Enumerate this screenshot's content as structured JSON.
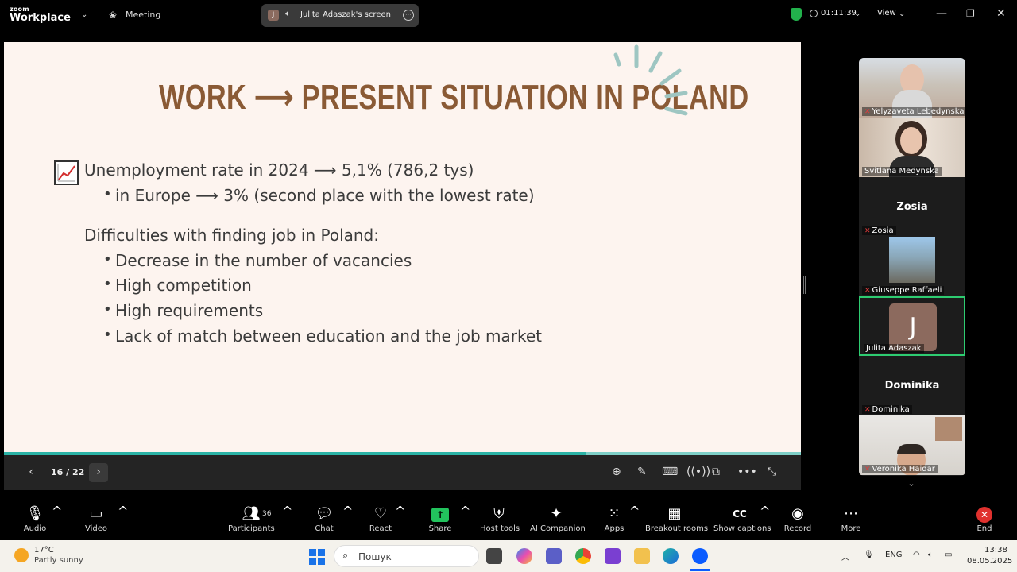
{
  "titlebar": {
    "logo_top": "zoom",
    "logo_bottom": "Workplace",
    "meeting_label": "Meeting",
    "share_avatar": "J",
    "share_text": "Julita Adaszak's screen",
    "timer": "01:11:39",
    "view_label": "View"
  },
  "slide": {
    "title": "WORK ⟶ PRESENT SITUATION IN POLAND",
    "line1": "Unemployment rate in 2024 ⟶ 5,1% (786,2 tys)",
    "line1_sub": "in Europe ⟶ 3% (second place with the lowest rate)",
    "heading2": "Difficulties with finding job in Poland:",
    "bullets": [
      "Decrease in the number of vacancies",
      "High competition",
      "High requirements",
      "Lack of match between education and the job market"
    ],
    "progress": 0.73
  },
  "slidebar": {
    "page_indicator": "16 / 22"
  },
  "participants": [
    {
      "name": "Yelyzaveta Lebedynska",
      "type": "video",
      "muted": true
    },
    {
      "name": "Svitlana Medynska",
      "type": "video",
      "muted": false
    },
    {
      "name": "Zosia",
      "type": "name",
      "display": "Zosia",
      "muted": true
    },
    {
      "name": "Giuseppe Raffaeli",
      "type": "video",
      "muted": true
    },
    {
      "name": "Julita Adaszak",
      "type": "avatar",
      "initial": "J",
      "muted": false,
      "active": true
    },
    {
      "name": "Dominika",
      "type": "name",
      "display": "Dominika",
      "muted": true
    },
    {
      "name": "Veronika Haidar",
      "type": "video",
      "muted": true
    }
  ],
  "toolbar": {
    "audio": "Audio",
    "video": "Video",
    "participants": "Participants",
    "participants_count": "36",
    "chat": "Chat",
    "react": "React",
    "share": "Share",
    "host_tools": "Host tools",
    "ai_companion": "AI Companion",
    "apps": "Apps",
    "breakout_rooms": "Breakout rooms",
    "show_captions": "Show captions",
    "record": "Record",
    "more": "More",
    "end": "End"
  },
  "taskbar": {
    "temp": "17°C",
    "weather": "Partly sunny",
    "search_placeholder": "Пошук",
    "lang": "ENG",
    "time": "13:38",
    "date": "08.05.2025"
  }
}
